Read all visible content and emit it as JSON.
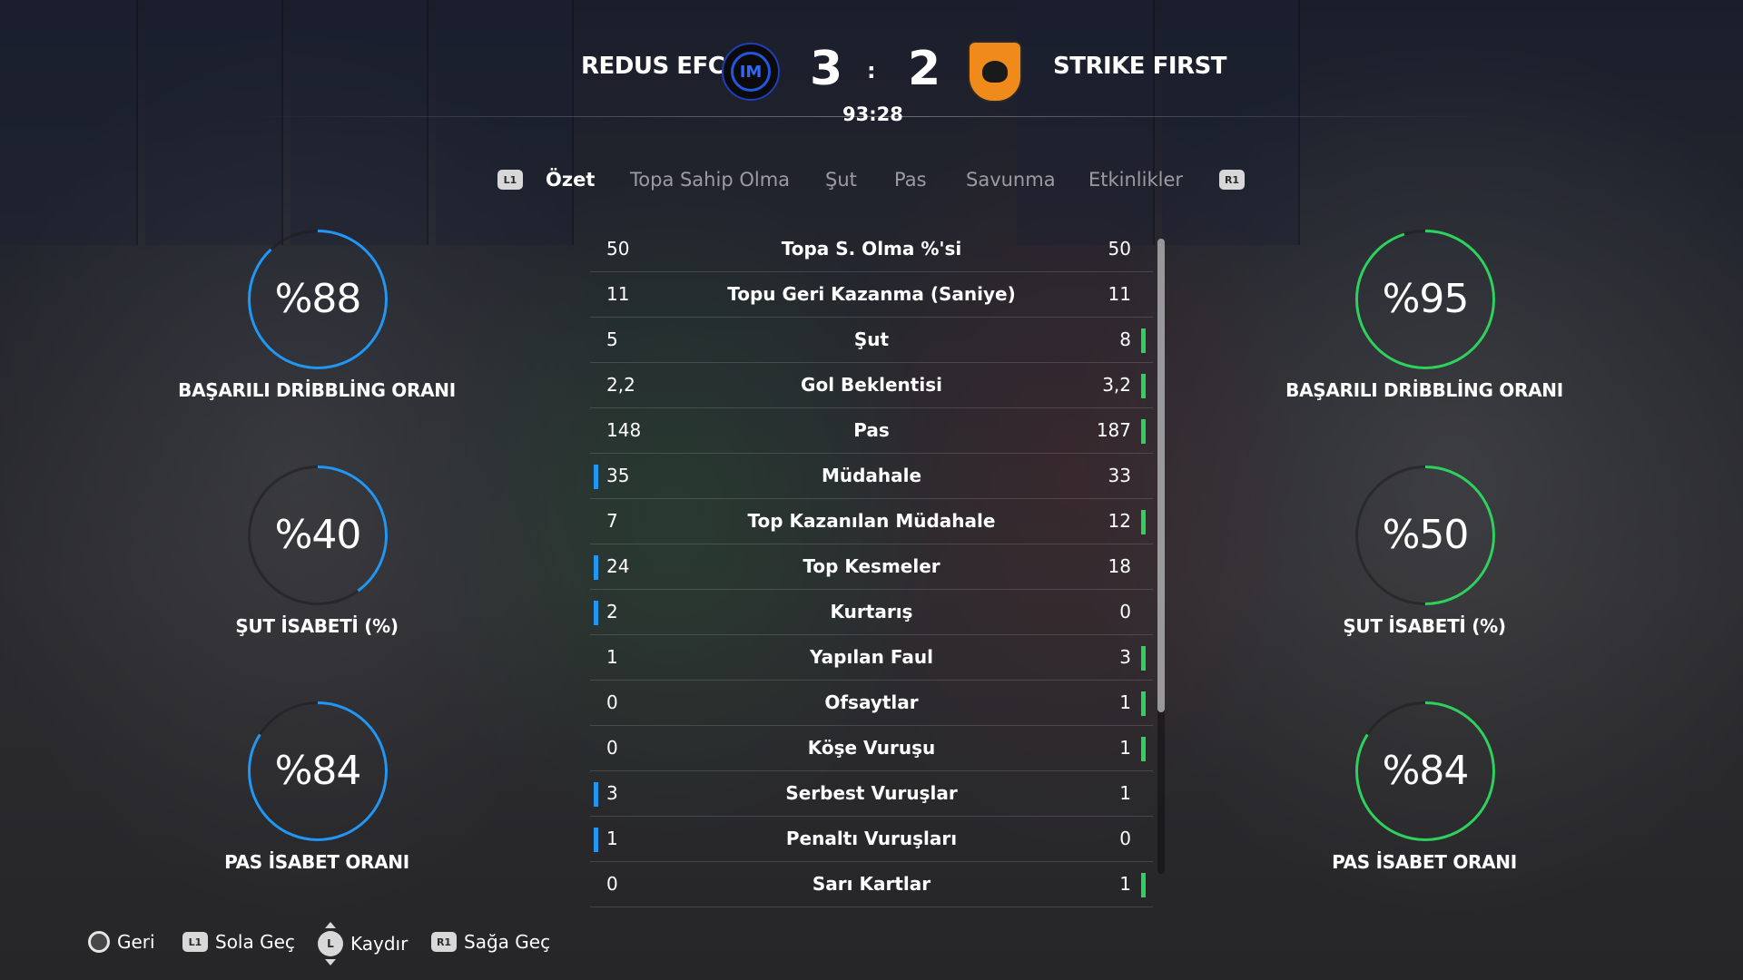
{
  "match": {
    "home_team": "REDUS EFC",
    "away_team": "STRIKE FIRST",
    "home_score": "3",
    "away_score": "2",
    "score_separator": ":",
    "clock": "93:28"
  },
  "tabs": {
    "left_button": "L1",
    "right_button": "R1",
    "items": [
      "Özet",
      "Topa Sahip Olma",
      "Şut",
      "Pas",
      "Savunma",
      "Etkinlikler"
    ],
    "active": "Özet"
  },
  "home_rings": [
    {
      "value": "%88",
      "label": "BAŞARILI DRİBBLİNG ORANI",
      "fill": 0.88
    },
    {
      "value": "%40",
      "label": "ŞUT İSABETİ (%)",
      "fill": 0.4
    },
    {
      "value": "%84",
      "label": "PAS İSABET ORANI",
      "fill": 0.84
    }
  ],
  "away_rings": [
    {
      "value": "%95",
      "label": "BAŞARILI DRİBBLİNG ORANI",
      "fill": 0.95
    },
    {
      "value": "%50",
      "label": "ŞUT İSABETİ (%)",
      "fill": 0.5
    },
    {
      "value": "%84",
      "label": "PAS İSABET ORANI",
      "fill": 0.84
    }
  ],
  "ring_colors": {
    "home": "#2196f3",
    "away": "#2fd15e"
  },
  "stats": [
    {
      "name": "Topa S. Olma %'si",
      "home": "50",
      "away": "50",
      "leader": "none"
    },
    {
      "name": "Topu Geri Kazanma (Saniye)",
      "home": "11",
      "away": "11",
      "leader": "none"
    },
    {
      "name": "Şut",
      "home": "5",
      "away": "8",
      "leader": "away"
    },
    {
      "name": "Gol Beklentisi",
      "home": "2,2",
      "away": "3,2",
      "leader": "away"
    },
    {
      "name": "Pas",
      "home": "148",
      "away": "187",
      "leader": "away"
    },
    {
      "name": "Müdahale",
      "home": "35",
      "away": "33",
      "leader": "home"
    },
    {
      "name": "Top Kazanılan Müdahale",
      "home": "7",
      "away": "12",
      "leader": "away"
    },
    {
      "name": "Top Kesmeler",
      "home": "24",
      "away": "18",
      "leader": "home"
    },
    {
      "name": "Kurtarış",
      "home": "2",
      "away": "0",
      "leader": "home"
    },
    {
      "name": "Yapılan Faul",
      "home": "1",
      "away": "3",
      "leader": "away"
    },
    {
      "name": "Ofsaytlar",
      "home": "0",
      "away": "1",
      "leader": "away"
    },
    {
      "name": "Köşe Vuruşu",
      "home": "0",
      "away": "1",
      "leader": "away"
    },
    {
      "name": "Serbest Vuruşlar",
      "home": "3",
      "away": "1",
      "leader": "home"
    },
    {
      "name": "Penaltı Vuruşları",
      "home": "1",
      "away": "0",
      "leader": "home"
    },
    {
      "name": "Sarı Kartlar",
      "home": "0",
      "away": "1",
      "leader": "away"
    }
  ],
  "footer": {
    "back": "Geri",
    "prev_button": "L1",
    "prev": "Sola Geç",
    "scroll_button": "L",
    "scroll": "Kaydır",
    "next_button": "R1",
    "next": "Sağa Geç"
  }
}
